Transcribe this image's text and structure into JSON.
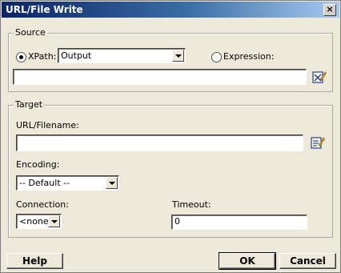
{
  "window": {
    "title": "URL/File Write",
    "close_glyph": "×"
  },
  "source": {
    "legend": "Source",
    "xpath_label": "XPath:",
    "xpath_value": "Output",
    "expression_label": "Expression:",
    "expression_value": ""
  },
  "target": {
    "legend": "Target",
    "url_label": "URL/Filename:",
    "url_value": "",
    "encoding_label": "Encoding:",
    "encoding_value": "-- Default --",
    "connection_label": "Connection:",
    "connection_value": "<none>",
    "timeout_label": "Timeout:",
    "timeout_value": "0"
  },
  "buttons": {
    "help": "Help",
    "ok": "OK",
    "cancel": "Cancel"
  }
}
